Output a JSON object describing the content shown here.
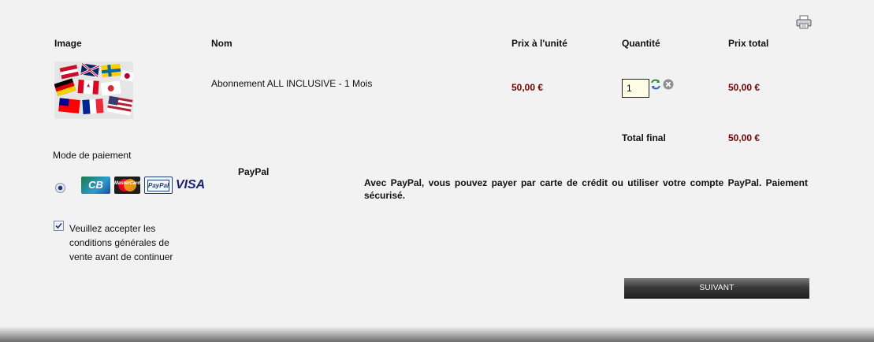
{
  "table": {
    "headers": {
      "image": "Image",
      "name": "Nom",
      "unit_price": "Prix à l'unité",
      "quantity": "Quantité",
      "total_price": "Prix total"
    },
    "item": {
      "name": "Abonnement ALL INCLUSIVE - 1 Mois",
      "unit_price": "50,00 €",
      "quantity": "1",
      "total_price": "50,00 €"
    },
    "final_total_label": "Total final",
    "final_total_value": "50,00 €"
  },
  "payment": {
    "title": "Mode de paiement",
    "method_name": "PayPal",
    "description": "Avec PayPal, vous pouvez payer par carte de crédit ou utiliser votre compte PayPal. Paiement sécurisé.",
    "selected": true,
    "cards": {
      "cb": "CB",
      "mastercard": "MasterCard",
      "paypal": "PayPal",
      "visa": "VISA"
    }
  },
  "terms": {
    "checked": true,
    "label": "Veuillez accepter les conditions générales de vente avant de continuer"
  },
  "actions": {
    "next_label": "SUIVANT"
  },
  "icons": {
    "print": "printer-icon",
    "refresh": "refresh-icon",
    "remove": "remove-icon"
  },
  "colors": {
    "background": "#f2f2f2",
    "price": "#7a0000",
    "button": "#2a2a2a"
  }
}
